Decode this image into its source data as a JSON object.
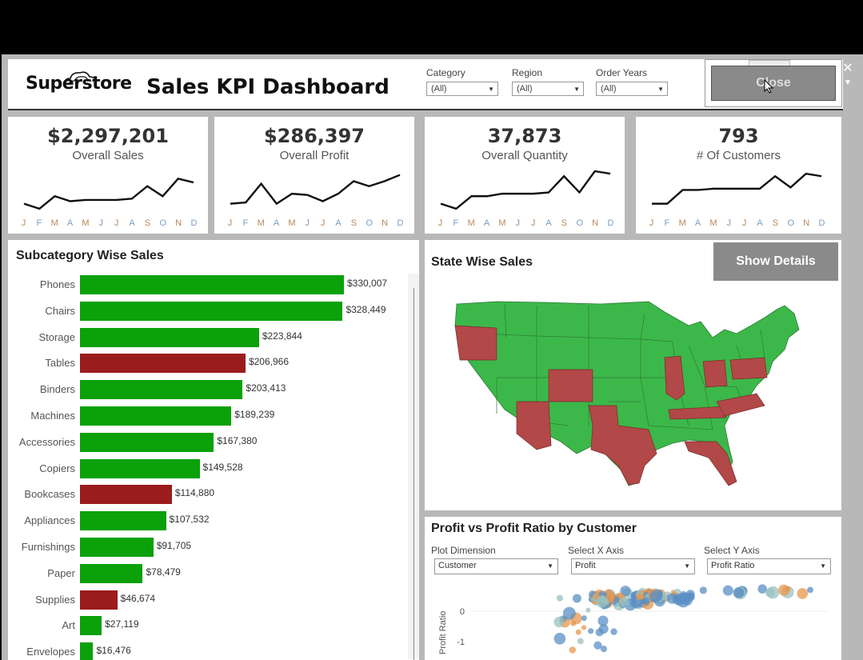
{
  "header": {
    "logo": "Superstore",
    "title": "Sales KPI Dashboard",
    "filters": [
      {
        "label": "Category",
        "value": "(All)"
      },
      {
        "label": "Region",
        "value": "(All)"
      },
      {
        "label": "Order Years",
        "value": "(All)"
      }
    ],
    "close_label": "Close"
  },
  "kpis": [
    {
      "value": "$2,297,201",
      "label": "Overall Sales",
      "trend": [
        3,
        1,
        6,
        4,
        4.5,
        4.5,
        4.5,
        5,
        10,
        6,
        13,
        11.5
      ]
    },
    {
      "value": "$286,397",
      "label": "Overall Profit",
      "trend": [
        3,
        3.5,
        11,
        3,
        7,
        6.5,
        4,
        7,
        12,
        10,
        12,
        14.5
      ]
    },
    {
      "value": "37,873",
      "label": "Overall Quantity",
      "trend": [
        3,
        1,
        6,
        6,
        7,
        7,
        7,
        7.5,
        14,
        7.5,
        16,
        15
      ]
    },
    {
      "value": "793",
      "label": "# Of Customers",
      "trend": [
        3,
        3,
        8.5,
        8.5,
        9,
        9,
        9,
        9,
        14,
        9.5,
        15,
        14
      ]
    }
  ],
  "months": [
    "J",
    "F",
    "M",
    "A",
    "M",
    "J",
    "J",
    "A",
    "S",
    "O",
    "N",
    "D"
  ],
  "colors": {
    "good": "#0aa10a",
    "bad": "#9b1c1c",
    "map_good": "#3cb84a",
    "map_bad": "#b24848",
    "month_a": "#b6875a",
    "month_b": "#7a9cc0"
  },
  "subcategory": {
    "title": "Subcategory Wise Sales",
    "rows": [
      {
        "name": "Phones",
        "value": 330007,
        "label": "$330,007",
        "status": "good"
      },
      {
        "name": "Chairs",
        "value": 328449,
        "label": "$328,449",
        "status": "good"
      },
      {
        "name": "Storage",
        "value": 223844,
        "label": "$223,844",
        "status": "good"
      },
      {
        "name": "Tables",
        "value": 206966,
        "label": "$206,966",
        "status": "bad"
      },
      {
        "name": "Binders",
        "value": 203413,
        "label": "$203,413",
        "status": "good"
      },
      {
        "name": "Machines",
        "value": 189239,
        "label": "$189,239",
        "status": "good"
      },
      {
        "name": "Accessories",
        "value": 167380,
        "label": "$167,380",
        "status": "good"
      },
      {
        "name": "Copiers",
        "value": 149528,
        "label": "$149,528",
        "status": "good"
      },
      {
        "name": "Bookcases",
        "value": 114880,
        "label": "$114,880",
        "status": "bad"
      },
      {
        "name": "Appliances",
        "value": 107532,
        "label": "$107,532",
        "status": "good"
      },
      {
        "name": "Furnishings",
        "value": 91705,
        "label": "$91,705",
        "status": "good"
      },
      {
        "name": "Paper",
        "value": 78479,
        "label": "$78,479",
        "status": "good"
      },
      {
        "name": "Supplies",
        "value": 46674,
        "label": "$46,674",
        "status": "bad"
      },
      {
        "name": "Art",
        "value": 27119,
        "label": "$27,119",
        "status": "good"
      },
      {
        "name": "Envelopes",
        "value": 16476,
        "label": "$16,476",
        "status": "good"
      }
    ]
  },
  "map": {
    "title": "State Wise Sales",
    "button": "Show Details"
  },
  "scatter": {
    "title": "Profit vs Profit Ratio by Customer",
    "controls": [
      {
        "label": "Plot Dimension",
        "value": "Customer"
      },
      {
        "label": "Select X Axis",
        "value": "Profit"
      },
      {
        "label": "Select Y Axis",
        "value": "Profit Ratio"
      }
    ],
    "y_ticks": [
      "0",
      "-1"
    ],
    "y_label": "Profit Ratio"
  }
}
